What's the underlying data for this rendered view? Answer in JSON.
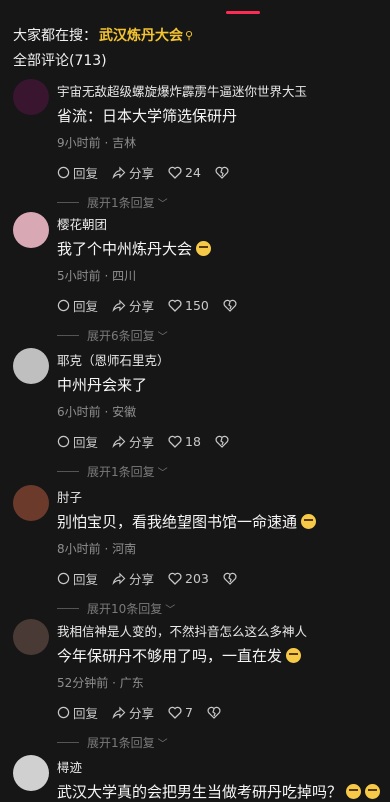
{
  "header": {
    "search_prefix": "大家都在搜：",
    "search_keyword": "武汉炼丹大会",
    "total_comments": "全部评论(713)"
  },
  "actions": {
    "reply_label": "回复",
    "share_label": "分享"
  },
  "comments": [
    {
      "username": "宇宙无敌超级螺旋爆炸霹雳牛逼迷你世界大玉",
      "text": "省流：日本大学筛选保研丹",
      "has_emoji": false,
      "meta": "9小时前 · 吉林",
      "likes": "24",
      "expand": "展开1条回复",
      "avatar_color": "#3a1530"
    },
    {
      "username": "樱花朝团",
      "text": "我了个中州炼丹大会",
      "has_emoji": true,
      "meta": "5小时前 · 四川",
      "likes": "150",
      "expand": "展开6条回复",
      "avatar_color": "#d9a8b5"
    },
    {
      "username": "耶克（恩师石里克）",
      "text": "中州丹会来了",
      "has_emoji": false,
      "meta": "6小时前 · 安徽",
      "likes": "18",
      "expand": "展开1条回复",
      "avatar_color": "#bfbfbf"
    },
    {
      "username": "肘子",
      "text": "别怕宝贝，看我绝望图书馆一命速通",
      "has_emoji": true,
      "meta": "8小时前 · 河南",
      "likes": "203",
      "expand": "展开10条回复",
      "avatar_color": "#6b3a2a"
    },
    {
      "username": "我相信神是人变的，不然抖音怎么这么多神人",
      "text": "今年保研丹不够用了吗，一直在发",
      "has_emoji": true,
      "meta": "52分钟前 · 广东",
      "likes": "7",
      "expand": "展开1条回复",
      "avatar_color": "#4a3a35"
    },
    {
      "username": "樳迹",
      "text": "武汉大学真的会把男生当做考研丹吃掉吗？",
      "has_emoji": true,
      "meta": "",
      "likes": "",
      "expand": "",
      "avatar_color": "#d0d0d0"
    }
  ]
}
